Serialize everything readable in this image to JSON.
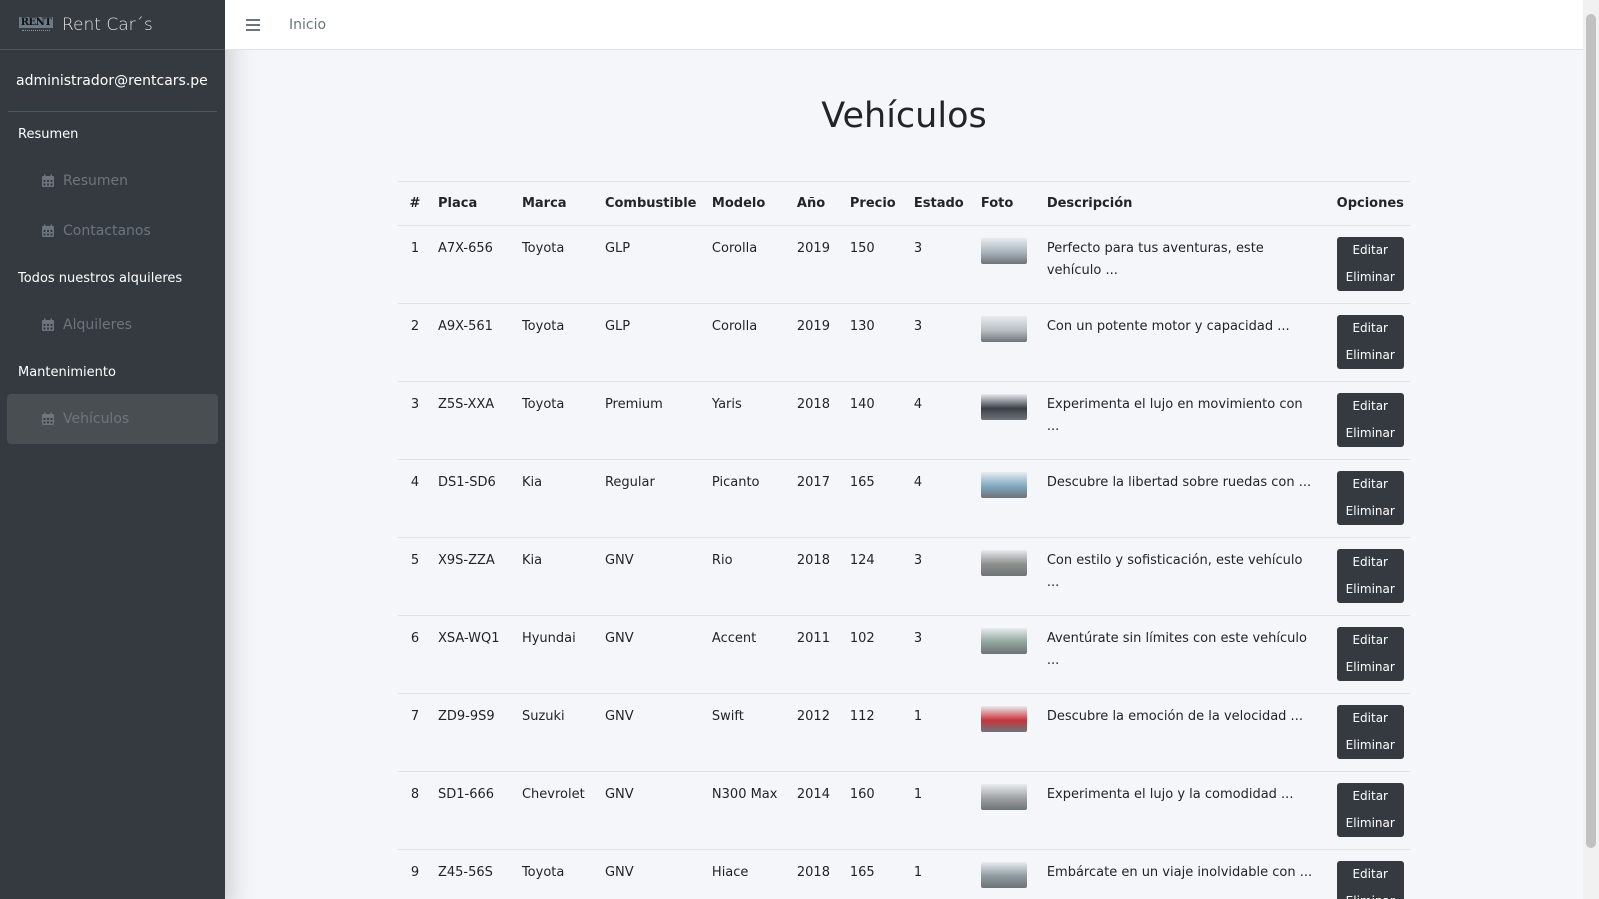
{
  "brand": {
    "name": "Rent Car´s",
    "logo_text": "RENT"
  },
  "user": {
    "email": "administrador@rentcars.pe"
  },
  "sidebar": {
    "sections": [
      {
        "header": "Resumen",
        "items": [
          {
            "label": "Resumen",
            "icon": "calendar-icon",
            "active": false
          },
          {
            "label": "Contactanos",
            "icon": "calendar-icon",
            "active": false
          }
        ]
      },
      {
        "header": "Todos nuestros alquileres",
        "items": [
          {
            "label": "Alquileres",
            "icon": "calendar-icon",
            "active": false
          }
        ]
      },
      {
        "header": "Mantenimiento",
        "items": [
          {
            "label": "Vehículos",
            "icon": "calendar-icon",
            "active": true
          }
        ]
      }
    ]
  },
  "topbar": {
    "menu_icon": "hamburger-icon",
    "home_link": "Inicio"
  },
  "page": {
    "title": "Vehículos"
  },
  "table": {
    "headers": [
      "#",
      "Placa",
      "Marca",
      "Combustible",
      "Modelo",
      "Año",
      "Precio",
      "Estado",
      "Foto",
      "Descripción",
      "Opciones"
    ],
    "rows": [
      {
        "num": "1",
        "placa": "A7X-656",
        "marca": "Toyota",
        "combustible": "GLP",
        "modelo": "Corolla",
        "anio": "2019",
        "precio": "150",
        "estado": "3",
        "foto_color": "#a9b4bd",
        "descripcion": "Perfecto para tus aventuras, este vehículo ..."
      },
      {
        "num": "2",
        "placa": "A9X-561",
        "marca": "Toyota",
        "combustible": "GLP",
        "modelo": "Corolla",
        "anio": "2019",
        "precio": "130",
        "estado": "3",
        "foto_color": "#b8bfc4",
        "descripcion": "Con un potente motor y capacidad ..."
      },
      {
        "num": "3",
        "placa": "Z5S-XXA",
        "marca": "Toyota",
        "combustible": "Premium",
        "modelo": "Yaris",
        "anio": "2018",
        "precio": "140",
        "estado": "4",
        "foto_color": "#3b3f48",
        "descripcion": "Experimenta el lujo en movimiento con ..."
      },
      {
        "num": "4",
        "placa": "DS1-SD6",
        "marca": "Kia",
        "combustible": "Regular",
        "modelo": "Picanto",
        "anio": "2017",
        "precio": "165",
        "estado": "4",
        "foto_color": "#7fa7bf",
        "descripcion": "Descubre la libertad sobre ruedas con ..."
      },
      {
        "num": "5",
        "placa": "X9S-ZZA",
        "marca": "Kia",
        "combustible": "GNV",
        "modelo": "Rio",
        "anio": "2018",
        "precio": "124",
        "estado": "3",
        "foto_color": "#8c8e8b",
        "descripcion": "Con estilo y sofisticación, este vehículo ..."
      },
      {
        "num": "6",
        "placa": "XSA-WQ1",
        "marca": "Hyundai",
        "combustible": "GNV",
        "modelo": "Accent",
        "anio": "2011",
        "precio": "102",
        "estado": "3",
        "foto_color": "#8fa59a",
        "descripcion": "Aventúrate sin límites con este vehículo ..."
      },
      {
        "num": "7",
        "placa": "ZD9-9S9",
        "marca": "Suzuki",
        "combustible": "GNV",
        "modelo": "Swift",
        "anio": "2012",
        "precio": "112",
        "estado": "1",
        "foto_color": "#c8343c",
        "descripcion": "Descubre la emoción de la velocidad ..."
      },
      {
        "num": "8",
        "placa": "SD1-666",
        "marca": "Chevrolet",
        "combustible": "GNV",
        "modelo": "N300 Max",
        "anio": "2014",
        "precio": "160",
        "estado": "1",
        "foto_color": "#9ea2a3",
        "descripcion": "Experimenta el lujo y la comodidad ..."
      },
      {
        "num": "9",
        "placa": "Z45-56S",
        "marca": "Toyota",
        "combustible": "GNV",
        "modelo": "Hiace",
        "anio": "2018",
        "precio": "165",
        "estado": "1",
        "foto_color": "#8d9aa0",
        "descripcion": "Embárcate en un viaje inolvidable con ..."
      }
    ],
    "actions": {
      "edit": "Editar",
      "delete": "Eliminar"
    }
  },
  "colors": {
    "sidebar_bg": "#343a40",
    "content_bg": "#f4f6f9",
    "button_bg": "#343a40"
  }
}
